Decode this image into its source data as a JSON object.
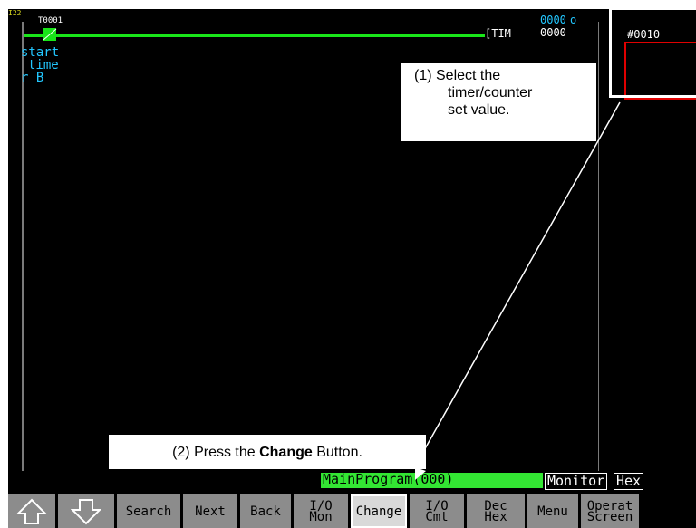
{
  "ladder": {
    "rung_number": "I22",
    "contact_address": "T0001",
    "contact_comment": [
      "start",
      "time",
      "r B"
    ],
    "instruction": "TIM",
    "timer_number": "0000",
    "set_value_display": "0000",
    "present_marker": "o",
    "set_value": "#0010"
  },
  "callouts": {
    "select_line1": "(1) Select the",
    "select_line2": "timer/counter",
    "select_line3": "set value.",
    "press_prefix": "(2) Press the ",
    "press_bold": "Change",
    "press_suffix": " Button."
  },
  "status": {
    "program": "MainProgram(000)",
    "mode": "Monitor",
    "format": "Hex"
  },
  "buttons": {
    "up": "up-arrow",
    "down": "down-arrow",
    "search": "Search",
    "next": "Next",
    "back": "Back",
    "io_mon_1": "I/O",
    "io_mon_2": "Mon",
    "change": "Change",
    "io_cmt_1": "I/O",
    "io_cmt_2": "Cmt",
    "dec_hex_1": "Dec",
    "dec_hex_2": "Hex",
    "menu": "Menu",
    "operat_1": "Operat",
    "operat_2": "Screen"
  },
  "colors": {
    "rung": "#19e619",
    "comment": "#22c7ff",
    "highlight": "#e00000",
    "status_green": "#33e633"
  }
}
